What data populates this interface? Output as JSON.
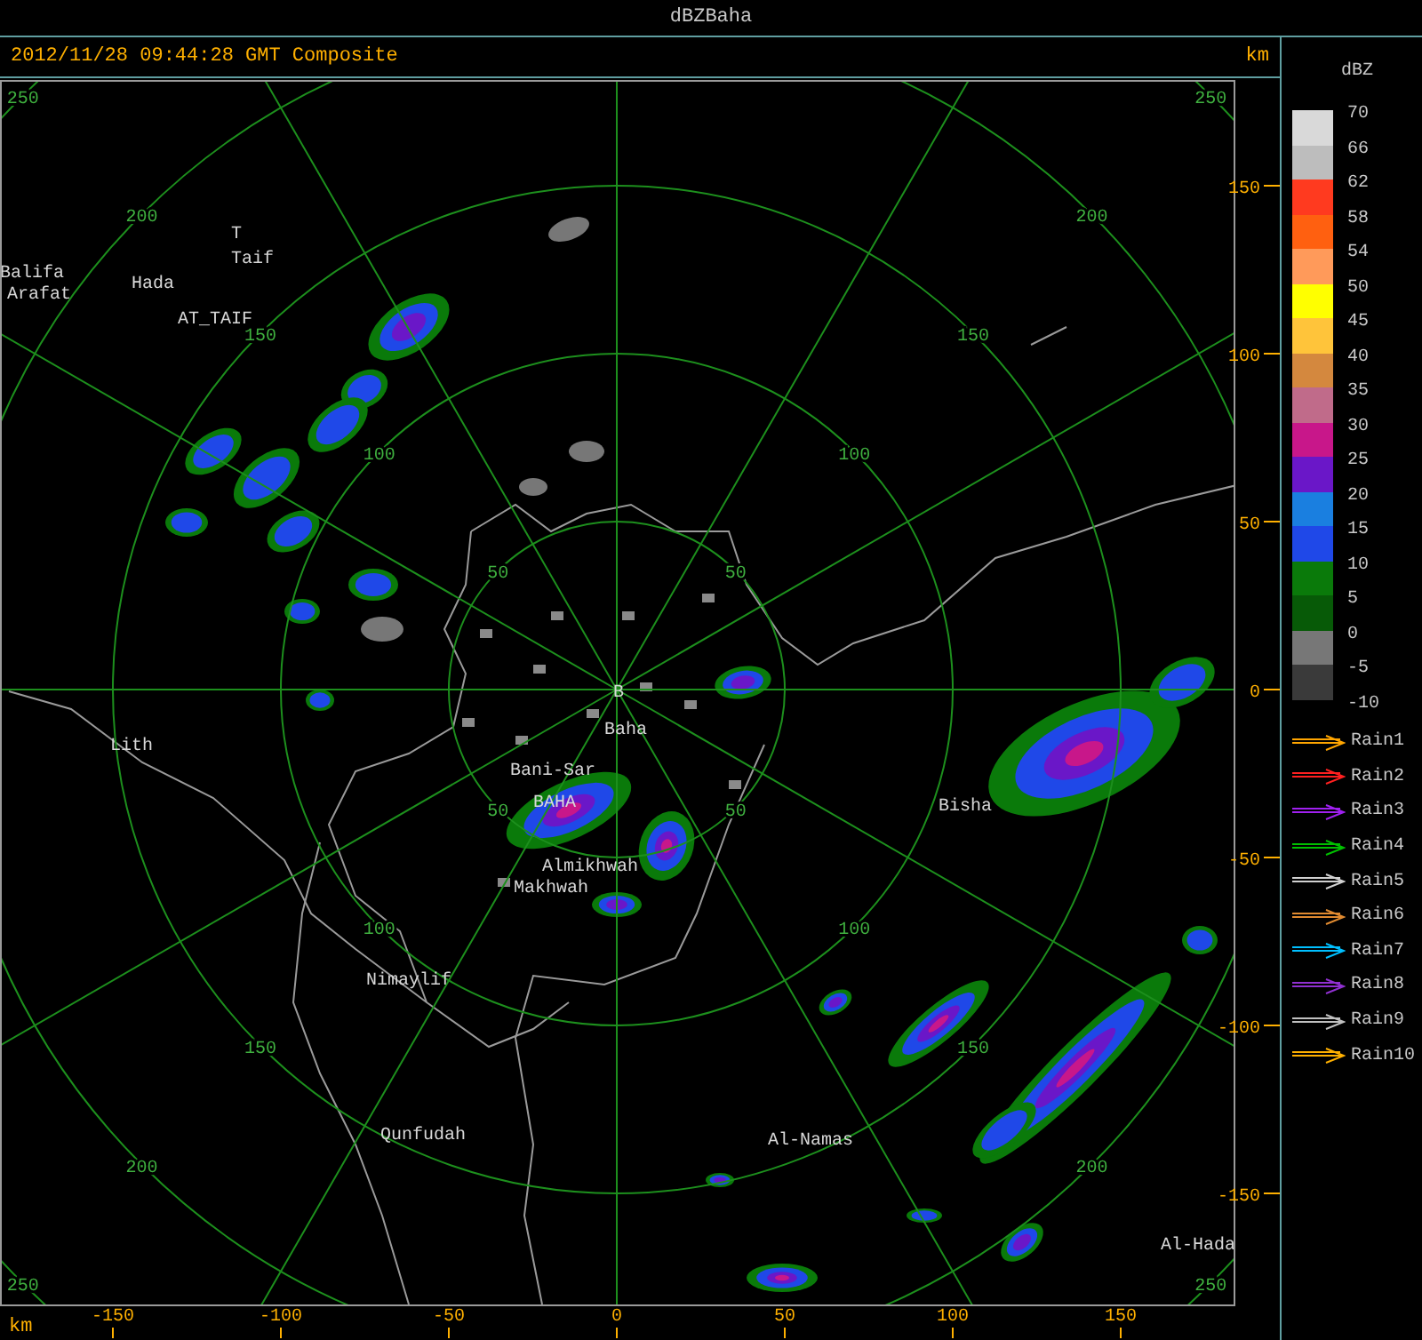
{
  "window": {
    "title": "dBZBaha"
  },
  "header": {
    "timestamp": "2012/11/28 09:44:28 GMT Composite",
    "unit": "km"
  },
  "map": {
    "rings": [
      {
        "labels": [
          "50",
          "50",
          "50",
          "50"
        ]
      },
      {
        "labels": [
          "100",
          "100",
          "100",
          "100"
        ]
      },
      {
        "labels": [
          "150",
          "150",
          "150",
          "150"
        ]
      },
      {
        "labels": [
          "200",
          "200",
          "200",
          "200"
        ]
      },
      {
        "labels": [
          "250",
          "250",
          "250",
          "250"
        ]
      }
    ],
    "places": [
      "T",
      "Taif",
      "Balifa",
      "Arafat",
      "Hada",
      "AT_TAIF",
      "Lith",
      "B",
      "Baha",
      "Bani-Sar",
      "BAHA",
      "Almikhwah",
      "Makhwah",
      "Bisha",
      "Nimaylif",
      "Qunfudah",
      "Al-Namas",
      "Al-Hada"
    ]
  },
  "x_axis": {
    "unit": "km",
    "ticks": [
      "-150",
      "-100",
      "-50",
      "0",
      "50",
      "100",
      "150"
    ]
  },
  "y_axis": {
    "ticks": [
      "150",
      "100",
      "50",
      "0",
      "-50",
      "-100",
      "-150"
    ]
  },
  "legend": {
    "title": "dBZ",
    "colors": [
      {
        "color": "#d9d9d9"
      },
      {
        "color": "#bdbdbd"
      },
      {
        "color": "#ff3a1f"
      },
      {
        "color": "#ff6010"
      },
      {
        "color": "#ff9a5a"
      },
      {
        "color": "#ffff00"
      },
      {
        "color": "#ffc43a"
      },
      {
        "color": "#d4883e"
      },
      {
        "color": "#c06b8a"
      },
      {
        "color": "#c8178a"
      },
      {
        "color": "#6a17c8"
      },
      {
        "color": "#1a7fe0"
      },
      {
        "color": "#1f48e8"
      },
      {
        "color": "#0a7a0a"
      },
      {
        "color": "#075a07"
      },
      {
        "color": "#777777"
      },
      {
        "color": "#3a3a3a"
      }
    ],
    "levels": [
      "70",
      "66",
      "62",
      "58",
      "54",
      "50",
      "45",
      "40",
      "35",
      "30",
      "25",
      "20",
      "15",
      "10",
      "5",
      "0",
      "-5",
      "-10"
    ]
  },
  "tracks": [
    {
      "name": "Rain1",
      "color": "#ffa500"
    },
    {
      "name": "Rain2",
      "color": "#ff2020"
    },
    {
      "name": "Rain3",
      "color": "#a020f0"
    },
    {
      "name": "Rain4",
      "color": "#00c000"
    },
    {
      "name": "Rain5",
      "color": "#d0d0d0"
    },
    {
      "name": "Rain6",
      "color": "#e08a30"
    },
    {
      "name": "Rain7",
      "color": "#00bfff"
    },
    {
      "name": "Rain8",
      "color": "#9030d0"
    },
    {
      "name": "Rain9",
      "color": "#c0c0c0"
    },
    {
      "name": "Rain10",
      "color": "#ffb000"
    }
  ]
}
